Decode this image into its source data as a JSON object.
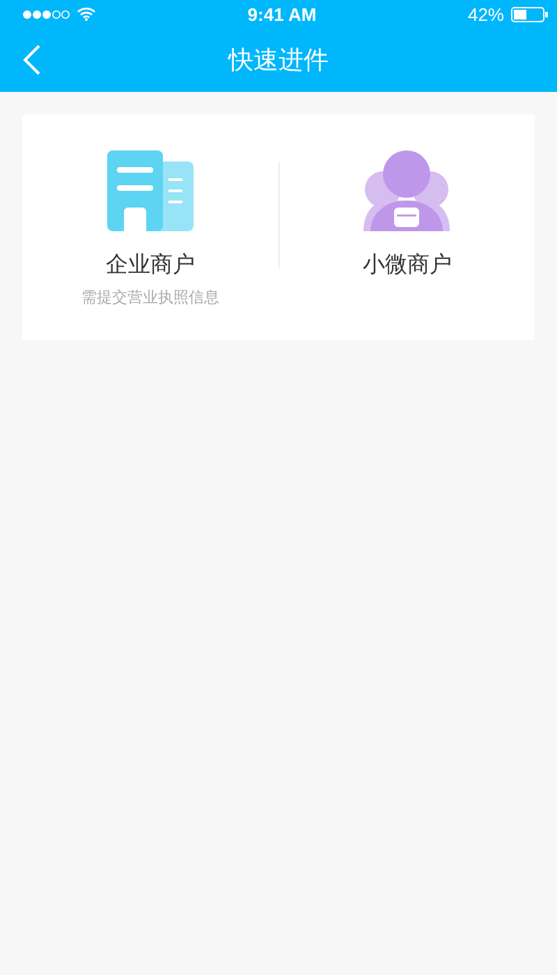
{
  "status_bar": {
    "time": "9:41 AM",
    "battery": "42%"
  },
  "nav_bar": {
    "title": "快速进件"
  },
  "options": [
    {
      "kind": "enterprise",
      "title": "企业商户",
      "subtitle": "需提交营业执照信息"
    },
    {
      "kind": "micro",
      "title": "小微商户"
    }
  ]
}
